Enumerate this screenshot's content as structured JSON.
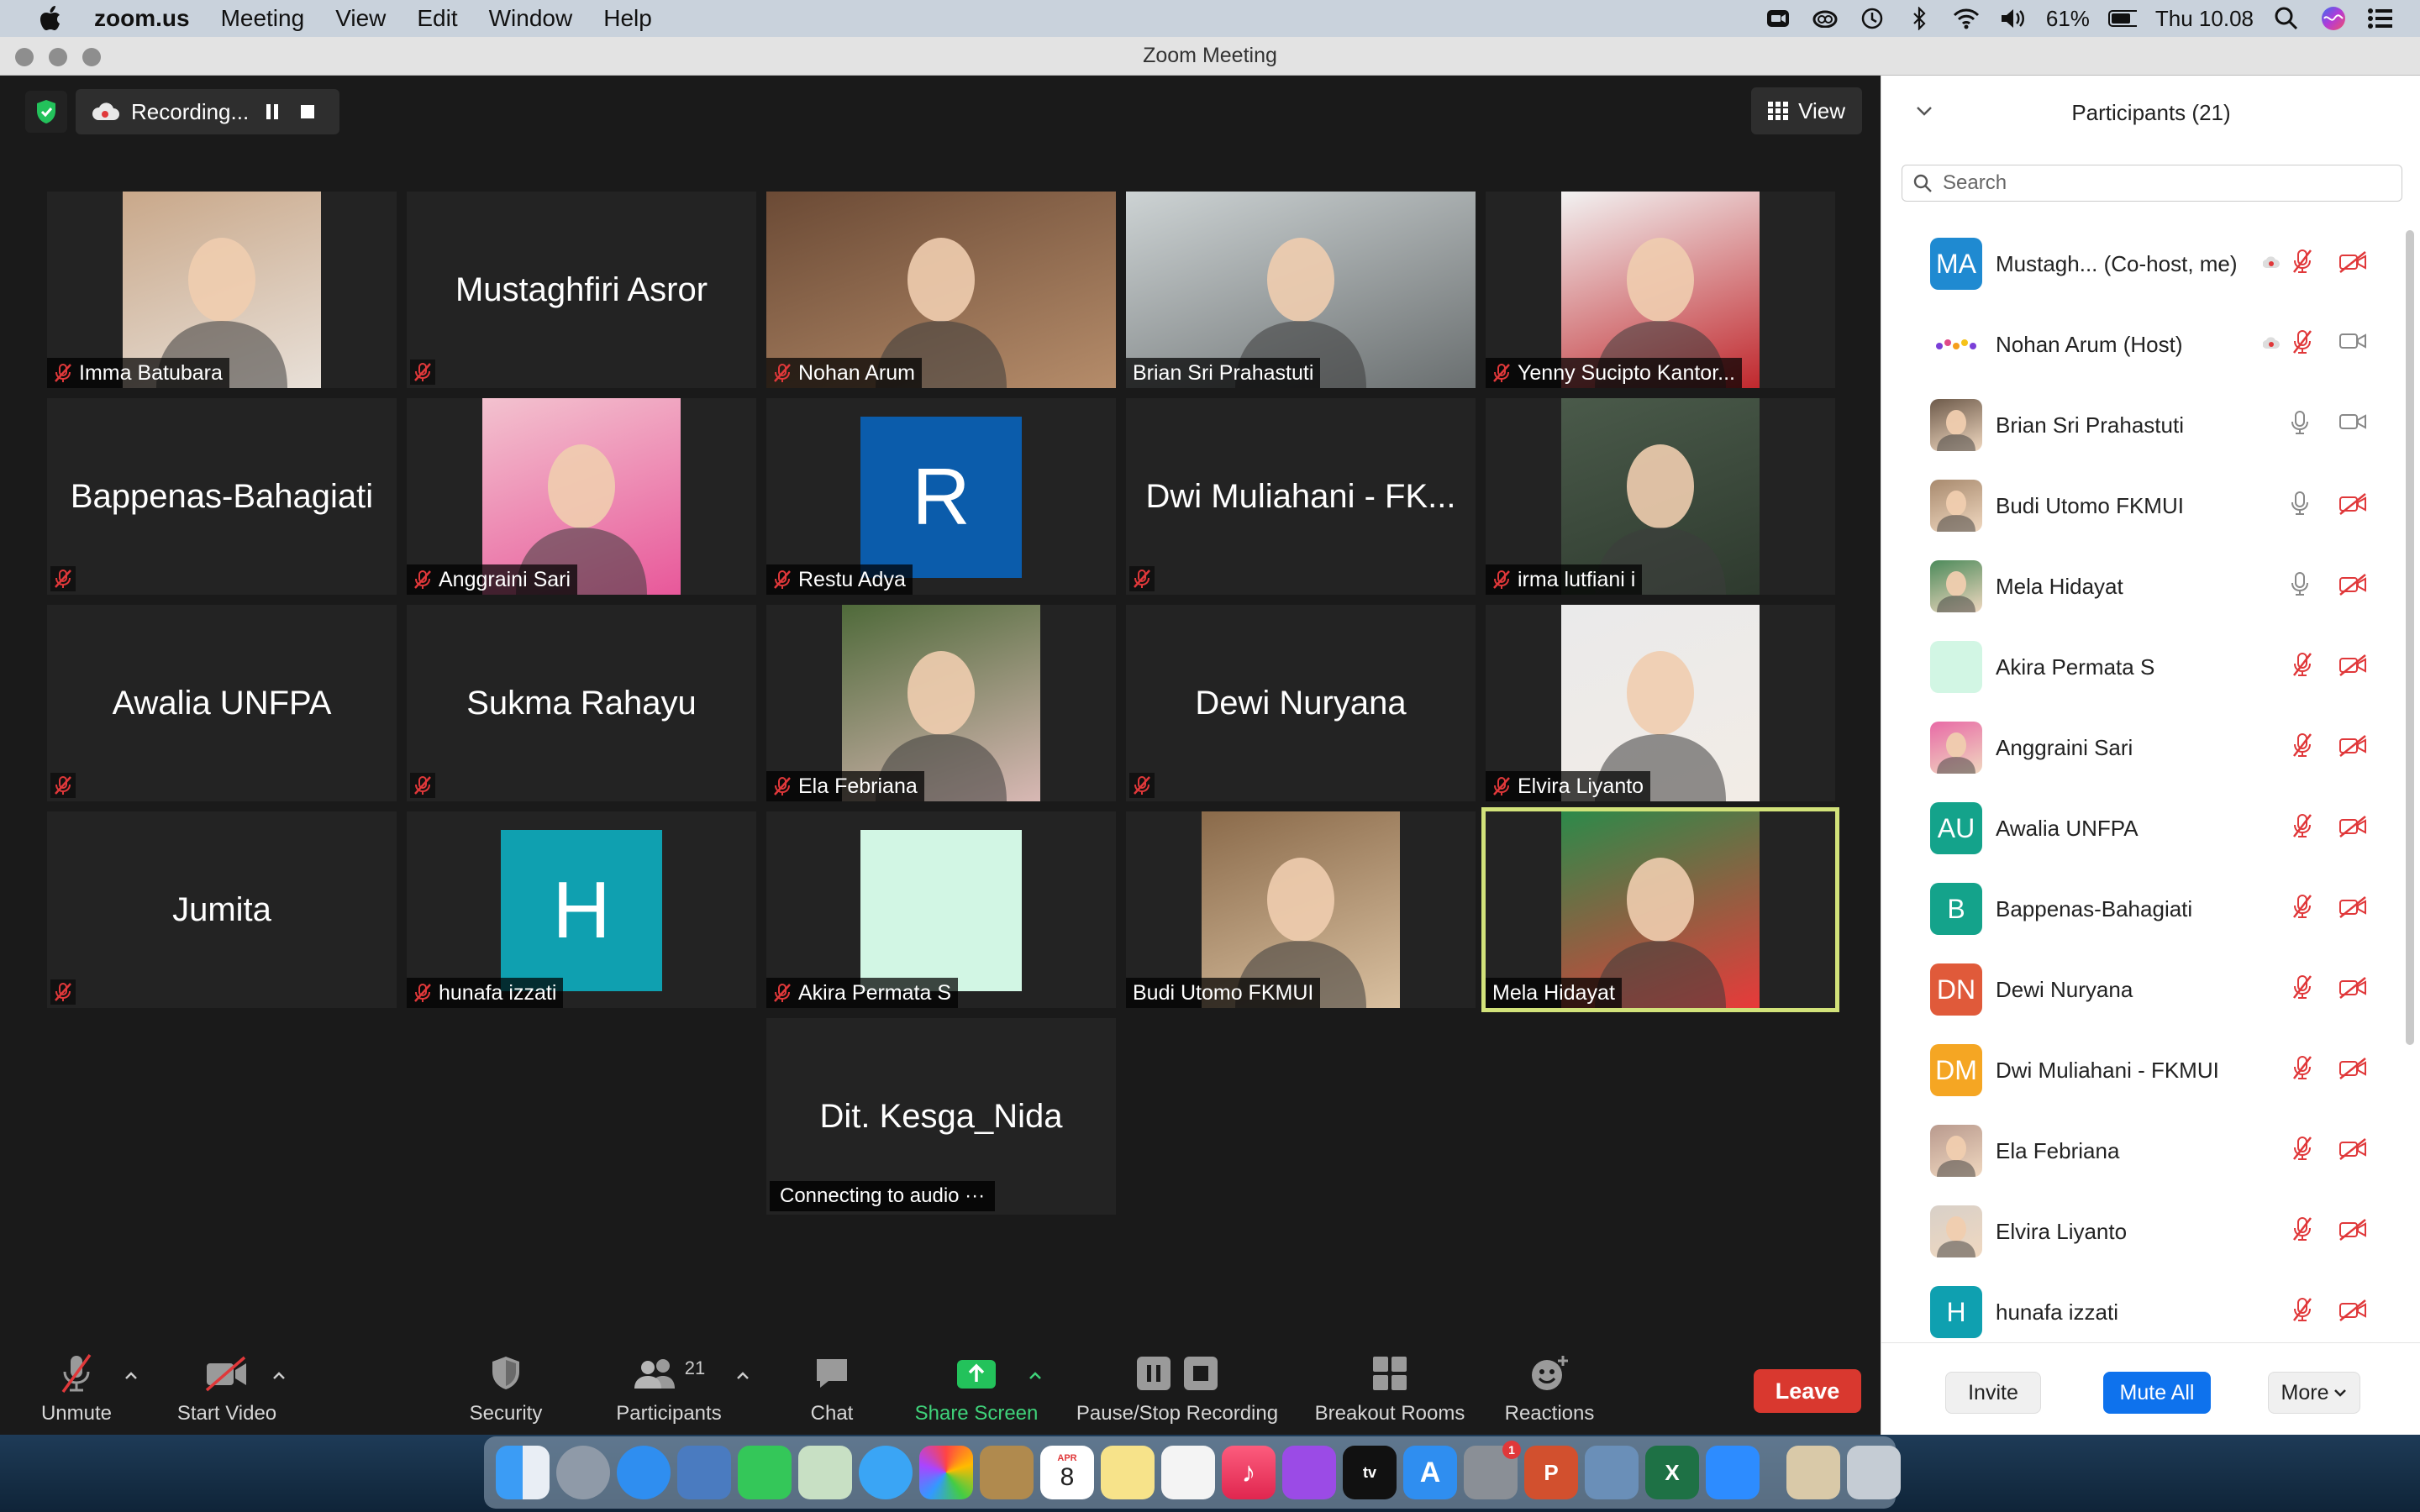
{
  "menubar": {
    "app": "zoom.us",
    "items": [
      "Meeting",
      "View",
      "Edit",
      "Window",
      "Help"
    ],
    "battery": "61%",
    "clock": "Thu 10.08"
  },
  "window": {
    "title": "Zoom Meeting"
  },
  "recording": {
    "label": "Recording..."
  },
  "view_button": {
    "label": "View"
  },
  "tiles": [
    {
      "name": "Imma Batubara",
      "kind": "video"
    },
    {
      "name": "Mustaghfiri Asror",
      "kind": "name"
    },
    {
      "name": "Nohan Arum",
      "kind": "video"
    },
    {
      "name": "Brian Sri Prahastuti",
      "kind": "video"
    },
    {
      "name": "Yenny Sucipto Kantor...",
      "kind": "video"
    },
    {
      "name": "Bappenas-Bahagiati",
      "kind": "name"
    },
    {
      "name": "Anggraini Sari",
      "kind": "video"
    },
    {
      "name": "Restu Adya",
      "kind": "initial",
      "initial": "R"
    },
    {
      "name": "Dwi Muliahani - FK...",
      "kind": "name"
    },
    {
      "name": "irma lutfiani i",
      "kind": "video"
    },
    {
      "name": "Awalia UNFPA",
      "kind": "name"
    },
    {
      "name": "Sukma Rahayu",
      "kind": "name"
    },
    {
      "name": "Ela Febriana",
      "kind": "video"
    },
    {
      "name": "Dewi Nuryana",
      "kind": "name"
    },
    {
      "name": "Elvira Liyanto",
      "kind": "video"
    },
    {
      "name": "Jumita",
      "kind": "name"
    },
    {
      "name": "hunafa izzati",
      "kind": "initial",
      "initial": "H"
    },
    {
      "name": "Akira Permata S",
      "kind": "blank"
    },
    {
      "name": "Budi Utomo FKMUI",
      "kind": "video"
    },
    {
      "name": "Mela Hidayat",
      "kind": "video",
      "active": true
    },
    {
      "name": "Dit. Kesga_Nida",
      "kind": "name",
      "status": "Connecting to audio ···"
    }
  ],
  "toolbar": {
    "unmute": "Unmute",
    "start_video": "Start Video",
    "security": "Security",
    "participants": "Participants",
    "participants_count": "21",
    "chat": "Chat",
    "share_screen": "Share Screen",
    "recording": "Pause/Stop Recording",
    "breakout": "Breakout Rooms",
    "reactions": "Reactions",
    "leave": "Leave"
  },
  "panel": {
    "title": "Participants (21)",
    "search_placeholder": "Search",
    "participants": [
      {
        "name": "Mustagh... (Co-host, me)",
        "avatar": "MA",
        "color": "#1f8ad1",
        "rec": true,
        "mic": "muted",
        "cam": "off"
      },
      {
        "name": "Nohan Arum (Host)",
        "avatar": "logo",
        "color": "#ffffff",
        "rec": true,
        "mic": "muted",
        "cam": "on"
      },
      {
        "name": "Brian Sri Prahastuti",
        "avatar": "photo",
        "color": "#6d5a4a",
        "mic": "on",
        "cam": "on"
      },
      {
        "name": "Budi Utomo FKMUI",
        "avatar": "photo",
        "color": "#a88a6e",
        "mic": "on",
        "cam": "off"
      },
      {
        "name": "Mela Hidayat",
        "avatar": "photo",
        "color": "#4c8a5a",
        "mic": "on",
        "cam": "off"
      },
      {
        "name": "Akira Permata S",
        "avatar": "blank",
        "color": "#d2f6e4",
        "mic": "muted",
        "cam": "off"
      },
      {
        "name": "Anggraini Sari",
        "avatar": "photo",
        "color": "#e86aa6",
        "mic": "muted",
        "cam": "off"
      },
      {
        "name": "Awalia UNFPA",
        "avatar": "AU",
        "color": "#14a38b",
        "mic": "muted",
        "cam": "off"
      },
      {
        "name": "Bappenas-Bahagiati",
        "avatar": "B",
        "color": "#14a38b",
        "mic": "muted",
        "cam": "off"
      },
      {
        "name": "Dewi Nuryana",
        "avatar": "DN",
        "color": "#e05a3a",
        "mic": "muted",
        "cam": "off"
      },
      {
        "name": "Dwi Muliahani - FKMUI",
        "avatar": "DM",
        "color": "#f5a623",
        "mic": "muted",
        "cam": "off"
      },
      {
        "name": "Ela Febriana",
        "avatar": "photo",
        "color": "#b99a8e",
        "mic": "muted",
        "cam": "off"
      },
      {
        "name": "Elvira Liyanto",
        "avatar": "photo",
        "color": "#d8d0c8",
        "mic": "muted",
        "cam": "off"
      },
      {
        "name": "hunafa izzati",
        "avatar": "H",
        "color": "#0fa0b0",
        "mic": "muted",
        "cam": "off"
      }
    ],
    "invite": "Invite",
    "mute_all": "Mute All",
    "more": "More"
  },
  "dock": {
    "calendar_month": "APR",
    "calendar_day": "8",
    "badge": "1"
  }
}
